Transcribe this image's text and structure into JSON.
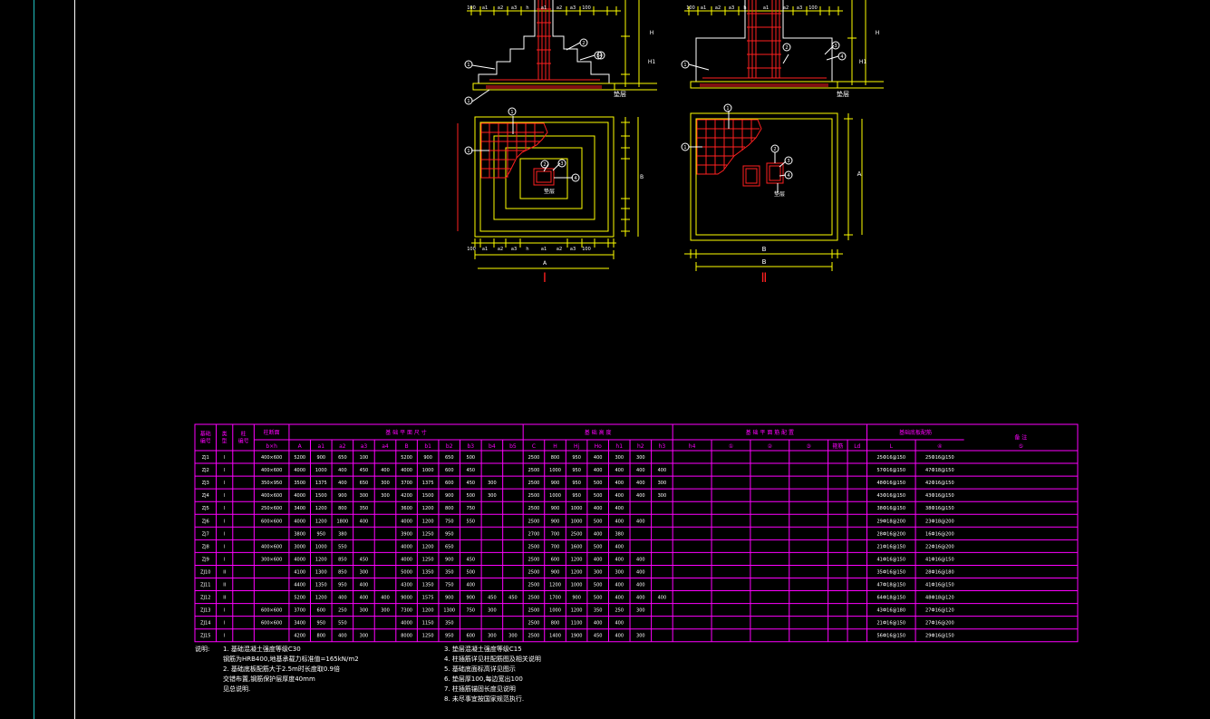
{
  "colors": {
    "background": "#000000",
    "yellow": "#ffff00",
    "red": "#ff2020",
    "magenta": "#ff00ff",
    "white": "#ffffff",
    "cyan": "#00ffff",
    "grid_line": "#7a7a7a"
  },
  "drawings": {
    "type1": {
      "mark": "Ⅰ",
      "plan_label_B": "B",
      "plan_label_A": "A",
      "pad_label": "垫层"
    },
    "type2": {
      "mark": "Ⅱ",
      "dim_B": "B",
      "dim_A": "A",
      "pad_label": "垫层"
    },
    "dims_top": [
      "100",
      "a1",
      "a2",
      "a3",
      "h",
      "a1",
      "a2",
      "a3",
      "100"
    ],
    "dims_h": [
      "H",
      "H1"
    ],
    "circle_tags": [
      "1",
      "2",
      "3",
      "4",
      "5"
    ]
  },
  "table": {
    "header_groups": [
      "基础\n编号",
      "类\n型",
      "柱\n编号",
      "柱断面",
      "基 础 平 面 尺 寸",
      "基 础 高 度",
      "基 础 平 面 筋 配 置",
      "基础底板配筋",
      "备  注"
    ],
    "col_headers": [
      "b×h",
      "A",
      "a1",
      "a2",
      "a3",
      "a4",
      "B",
      "b1",
      "b2",
      "b3",
      "b4",
      "b5",
      "C",
      "H",
      "Hj",
      "Ho",
      "h1",
      "h2",
      "h3",
      "h4",
      "①",
      "②",
      "③",
      "箍筋",
      "Ld",
      "L",
      "④",
      "⑤"
    ],
    "rows": [
      [
        "ZJ1",
        "I",
        "",
        "400×600",
        "5200",
        "900",
        "650",
        "100",
        "",
        "5200",
        "900",
        "650",
        "500",
        "",
        "",
        "2500",
        "800",
        "950",
        "400",
        "300",
        "300",
        "",
        "",
        "",
        "",
        "",
        "",
        "",
        "25Ф16@150",
        "25Ф16@150",
        ""
      ],
      [
        "ZJ2",
        "I",
        "",
        "400×600",
        "4000",
        "1000",
        "400",
        "450",
        "400",
        "4000",
        "1000",
        "600",
        "450",
        "",
        "",
        "2500",
        "1000",
        "950",
        "400",
        "400",
        "400",
        "400",
        "",
        "",
        "",
        "",
        "",
        "",
        "57Ф16@150",
        "47Ф18@150",
        ""
      ],
      [
        "ZJ3",
        "I",
        "",
        "350×950",
        "3500",
        "1375",
        "400",
        "650",
        "300",
        "3700",
        "1375",
        "600",
        "450",
        "300",
        "",
        "2500",
        "900",
        "950",
        "500",
        "400",
        "400",
        "300",
        "",
        "",
        "",
        "",
        "",
        "",
        "48Ф16@150",
        "42Ф16@150",
        ""
      ],
      [
        "ZJ4",
        "I",
        "",
        "400×600",
        "4000",
        "1500",
        "900",
        "300",
        "300",
        "4200",
        "1500",
        "900",
        "500",
        "300",
        "",
        "2500",
        "1000",
        "950",
        "500",
        "400",
        "400",
        "300",
        "",
        "",
        "",
        "",
        "",
        "",
        "43Ф16@150",
        "43Ф16@150",
        ""
      ],
      [
        "ZJ5",
        "I",
        "",
        "250×600",
        "3400",
        "1200",
        "800",
        "350",
        "",
        "3600",
        "1200",
        "800",
        "750",
        "",
        "",
        "2500",
        "900",
        "1000",
        "400",
        "400",
        "",
        "",
        "",
        "",
        "",
        "",
        "",
        "",
        "38Ф16@150",
        "38Ф16@150",
        ""
      ],
      [
        "ZJ6",
        "I",
        "",
        "600×600",
        "4000",
        "1200",
        "1800",
        "400",
        "",
        "4000",
        "1200",
        "750",
        "550",
        "",
        "",
        "2500",
        "900",
        "1000",
        "500",
        "400",
        "400",
        "",
        "",
        "",
        "",
        "",
        "",
        "",
        "29Ф18@200",
        "23Ф18@200",
        ""
      ],
      [
        "ZJ7",
        "I",
        "",
        "",
        "3800",
        "950",
        "380",
        "",
        "",
        "3900",
        "1250",
        "950",
        "",
        "",
        "",
        "2700",
        "700",
        "2500",
        "400",
        "380",
        "",
        "",
        "",
        "",
        "",
        "",
        "",
        "",
        "28Ф16@200",
        "16Ф16@200",
        ""
      ],
      [
        "ZJ8",
        "I",
        "",
        "400×600",
        "3000",
        "1000",
        "550",
        "",
        "",
        "4000",
        "1200",
        "650",
        "",
        "",
        "",
        "2500",
        "700",
        "1600",
        "500",
        "400",
        "",
        "",
        "",
        "",
        "",
        "",
        "",
        "",
        "21Ф16@150",
        "22Ф16@200",
        ""
      ],
      [
        "ZJ9",
        "I",
        "",
        "300×600",
        "4000",
        "1200",
        "850",
        "450",
        "",
        "4000",
        "1250",
        "900",
        "450",
        "",
        "",
        "2500",
        "600",
        "1200",
        "400",
        "400",
        "400",
        "",
        "",
        "",
        "",
        "",
        "",
        "",
        "41Ф16@150",
        "41Ф16@150",
        ""
      ],
      [
        "ZJ10",
        "II",
        "",
        "",
        "4100",
        "1300",
        "850",
        "300",
        "",
        "5000",
        "1350",
        "350",
        "500",
        "",
        "",
        "2500",
        "900",
        "1200",
        "300",
        "300",
        "400",
        "",
        "",
        "",
        "",
        "",
        "",
        "",
        "35Ф16@150",
        "28Ф16@180",
        ""
      ],
      [
        "ZJ11",
        "II",
        "",
        "",
        "4400",
        "1350",
        "950",
        "400",
        "",
        "4300",
        "1350",
        "750",
        "400",
        "",
        "",
        "2500",
        "1200",
        "1000",
        "500",
        "400",
        "400",
        "",
        "",
        "",
        "",
        "",
        "",
        "",
        "47Ф18@150",
        "41Ф16@150",
        ""
      ],
      [
        "ZJ12",
        "II",
        "",
        "",
        "5200",
        "1200",
        "400",
        "400",
        "400",
        "9000",
        "1575",
        "900",
        "900",
        "450",
        "450",
        "2500",
        "1700",
        "900",
        "500",
        "400",
        "400",
        "400",
        "",
        "",
        "",
        "",
        "",
        "",
        "64Ф18@150",
        "48Ф18@120",
        ""
      ],
      [
        "ZJ13",
        "I",
        "",
        "600×600",
        "3700",
        "600",
        "250",
        "300",
        "300",
        "7300",
        "1200",
        "1300",
        "750",
        "300",
        "",
        "2500",
        "1000",
        "1200",
        "350",
        "250",
        "300",
        "",
        "",
        "",
        "",
        "",
        "",
        "",
        "43Ф16@180",
        "27Ф16@120",
        ""
      ],
      [
        "ZJ14",
        "I",
        "",
        "600×600",
        "3400",
        "950",
        "550",
        "",
        "",
        "4000",
        "1150",
        "350",
        "",
        "",
        "",
        "2500",
        "800",
        "1100",
        "400",
        "400",
        "",
        "",
        "",
        "",
        "",
        "",
        "",
        "",
        "21Ф16@150",
        "27Ф16@200",
        ""
      ],
      [
        "ZJ15",
        "I",
        "",
        "",
        "4200",
        "800",
        "400",
        "300",
        "",
        "8000",
        "1250",
        "950",
        "600",
        "300",
        "300",
        "2500",
        "1400",
        "1900",
        "450",
        "400",
        "300",
        "",
        "",
        "",
        "",
        "",
        "",
        "",
        "56Ф16@150",
        "29Ф16@150",
        ""
      ]
    ]
  },
  "notes": {
    "label": "说明:",
    "left": [
      "1. 基础混凝土强度等级C30",
      "   钢筋为HRB400,地基承载力标准值=165kN/m2",
      "2. 基础底板配筋大于2.5m时长度取0.9倍",
      "   交错布置,钢筋保护层厚度40mm",
      "   见总说明."
    ],
    "right": [
      "3. 垫层混凝土强度等级C15",
      "4. 柱插筋详见柱配筋图及相关说明",
      "5. 基础底面标高详见图示",
      "6. 垫层厚100,每边宽出100",
      "7. 柱插筋锚固长度见说明",
      "8. 未尽事宜按国家规范执行."
    ]
  }
}
